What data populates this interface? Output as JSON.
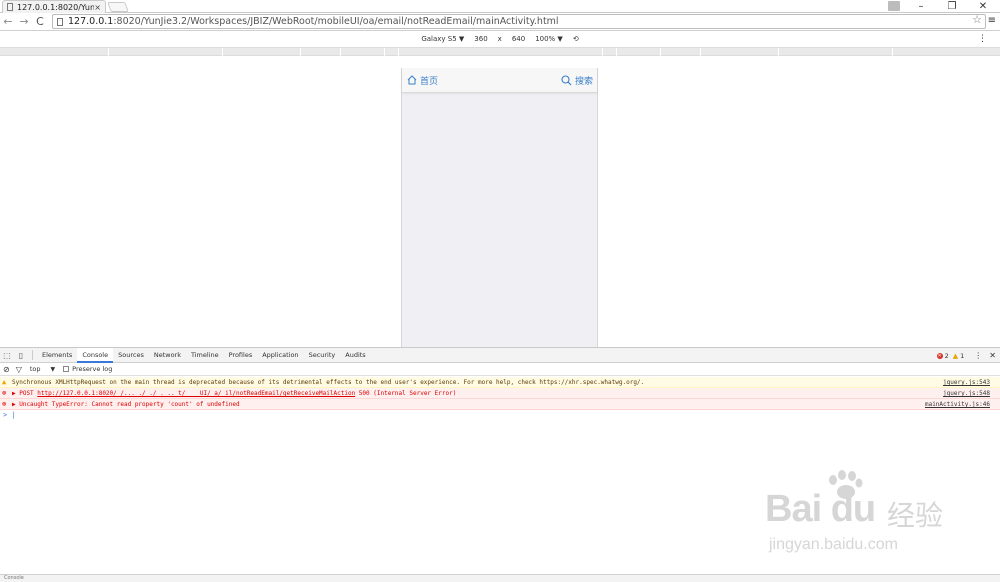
{
  "browser": {
    "tab_title": "127.0.0.1:8020/Yun",
    "tab_close": "×",
    "url_host": "127.0.0.1",
    "url_path": ":8020/YunJie3.2/Workspaces/JBIZ/WebRoot/mobileUI/oa/email/notReadEmail/mainActivity.html",
    "window_minimize": "–",
    "window_restore": "❐",
    "window_close": "✕",
    "back": "←",
    "forward": "→",
    "reload": "C",
    "star": "☆",
    "menu": "≡"
  },
  "device_toolbar": {
    "device": "Galaxy S5 ▼",
    "width": "360",
    "times": "x",
    "height": "640",
    "zoom": "100% ▼",
    "rotate": "⟲",
    "more": "⋮"
  },
  "app": {
    "home_label": "首页",
    "search_label": "搜索",
    "accent_color": "#3a7fc8"
  },
  "devtools": {
    "tabs": [
      "Elements",
      "Console",
      "Sources",
      "Network",
      "Timeline",
      "Profiles",
      "Application",
      "Security",
      "Audits"
    ],
    "error_count": "2",
    "warning_count": "1",
    "context": "top",
    "context_arrow": "▼",
    "preserve_log": "Preserve log",
    "messages": [
      {
        "type": "warning",
        "text": "Synchronous XMLHttpRequest on the main thread is deprecated because of its detrimental effects to the end user's experience. For more help, check https://xhr.spec.whatwg.org/.",
        "source": "jquery.js:543"
      },
      {
        "type": "error",
        "prefix": "▶ POST ",
        "link": "http://127.0.0.1:8020/         /...       ./    ./  . .. t/    ___UI/  a/   il/notReadEmail/getReceiveMailAction",
        "suffix": " 500 (Internal Server Error)",
        "source": "jquery.js:548"
      },
      {
        "type": "error",
        "text": "▶ Uncaught TypeError: Cannot read property 'count' of undefined",
        "source": "mainActivity.js:46"
      }
    ],
    "prompt": "> |",
    "bottom_tab": "Console"
  },
  "watermark": {
    "logo": "Bai du",
    "cn": "经验",
    "url": "jingyan.baidu.com"
  }
}
